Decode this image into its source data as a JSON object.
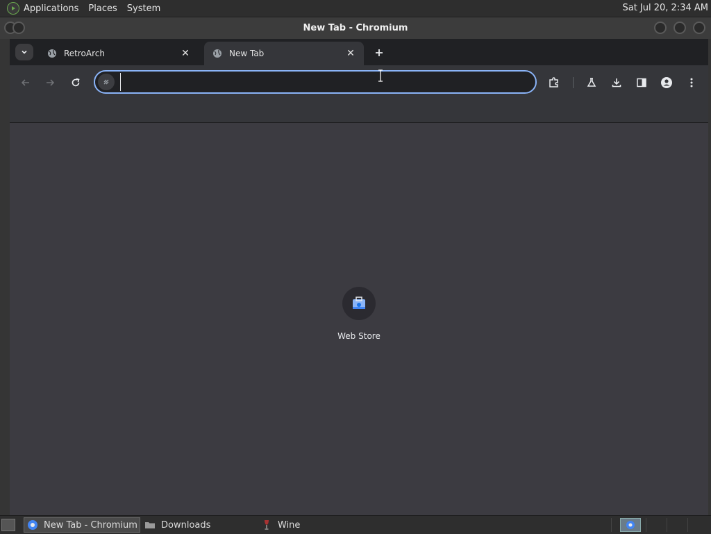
{
  "top_panel": {
    "menus": [
      "Applications",
      "Places",
      "System"
    ],
    "clock": "Sat Jul 20,  2:34 AM"
  },
  "window": {
    "title": "New Tab - Chromium"
  },
  "tabs": [
    {
      "title": "RetroArch",
      "icon": "globe-icon",
      "active": false
    },
    {
      "title": "New Tab",
      "icon": "globe-icon",
      "active": true
    }
  ],
  "toolbar": {
    "omnibox_value": "",
    "accent_color": "#8ab4f8"
  },
  "ntp": {
    "shortcuts": [
      {
        "label": "Web Store",
        "icon": "web-store-icon"
      }
    ]
  },
  "taskbar": {
    "items": [
      {
        "label": "New Tab - Chromium",
        "icon": "chromium-icon",
        "active": true
      },
      {
        "label": "Downloads",
        "icon": "folder-icon",
        "active": false
      },
      {
        "label": "Wine",
        "icon": "wine-icon",
        "active": false
      }
    ]
  }
}
